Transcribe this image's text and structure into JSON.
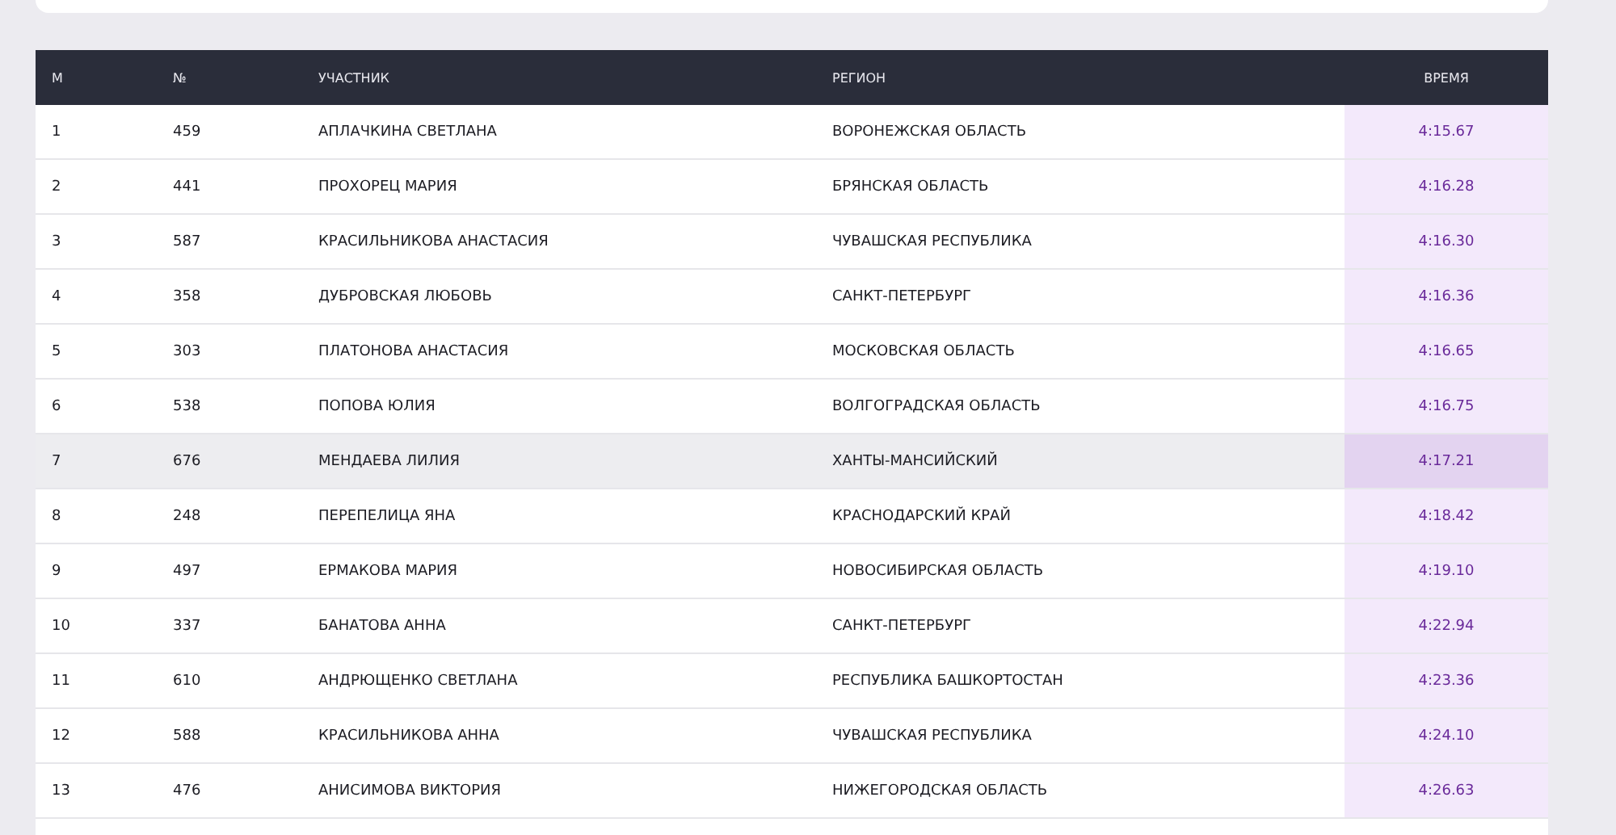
{
  "table": {
    "columns": [
      "М",
      "№",
      "УЧАСТНИК",
      "РЕГИОН",
      "ВРЕМЯ"
    ],
    "rows": [
      {
        "cells": [
          "1",
          "459",
          "АПЛАЧКИНА СВЕТЛАНА",
          "ВОРОНЕЖСКАЯ ОБЛАСТЬ",
          "4:15.67"
        ],
        "selected": false
      },
      {
        "cells": [
          "2",
          "441",
          "ПРОХОРЕЦ МАРИЯ",
          "БРЯНСКАЯ ОБЛАСТЬ",
          "4:16.28"
        ],
        "selected": false
      },
      {
        "cells": [
          "3",
          "587",
          "КРАСИЛЬНИКОВА АНАСТАСИЯ",
          "ЧУВАШСКАЯ РЕСПУБЛИКА",
          "4:16.30"
        ],
        "selected": false
      },
      {
        "cells": [
          "4",
          "358",
          "ДУБРОВСКАЯ ЛЮБОВЬ",
          "САНКТ-ПЕТЕРБУРГ",
          "4:16.36"
        ],
        "selected": false
      },
      {
        "cells": [
          "5",
          "303",
          "ПЛАТОНОВА АНАСТАСИЯ",
          "МОСКОВСКАЯ ОБЛАСТЬ",
          "4:16.65"
        ],
        "selected": false
      },
      {
        "cells": [
          "6",
          "538",
          "ПОПОВА ЮЛИЯ",
          "ВОЛГОГРАДСКАЯ ОБЛАСТЬ",
          "4:16.75"
        ],
        "selected": false
      },
      {
        "cells": [
          "7",
          "676",
          "МЕНДАЕВА ЛИЛИЯ",
          "ХАНТЫ-МАНСИЙСКИЙ",
          "4:17.21"
        ],
        "selected": true
      },
      {
        "cells": [
          "8",
          "248",
          "ПЕРЕПЕЛИЦА ЯНА",
          "КРАСНОДАРСКИЙ КРАЙ",
          "4:18.42"
        ],
        "selected": false
      },
      {
        "cells": [
          "9",
          "497",
          "ЕРМАКОВА МАРИЯ",
          "НОВОСИБИРСКАЯ ОБЛАСТЬ",
          "4:19.10"
        ],
        "selected": false
      },
      {
        "cells": [
          "10",
          "337",
          "БАНАТОВА АННА",
          "САНКТ-ПЕТЕРБУРГ",
          "4:22.94"
        ],
        "selected": false
      },
      {
        "cells": [
          "11",
          "610",
          "АНДРЮЩЕНКО СВЕТЛАНА",
          "РЕСПУБЛИКА БАШКОРТОСТАН",
          "4:23.36"
        ],
        "selected": false
      },
      {
        "cells": [
          "12",
          "588",
          "КРАСИЛЬНИКОВА АННА",
          "ЧУВАШСКАЯ РЕСПУБЛИКА",
          "4:24.10"
        ],
        "selected": false
      },
      {
        "cells": [
          "13",
          "476",
          "АНИСИМОВА ВИКТОРИЯ",
          "НИЖЕГОРОДСКАЯ ОБЛАСТЬ",
          "4:26.63"
        ],
        "selected": false
      }
    ]
  }
}
